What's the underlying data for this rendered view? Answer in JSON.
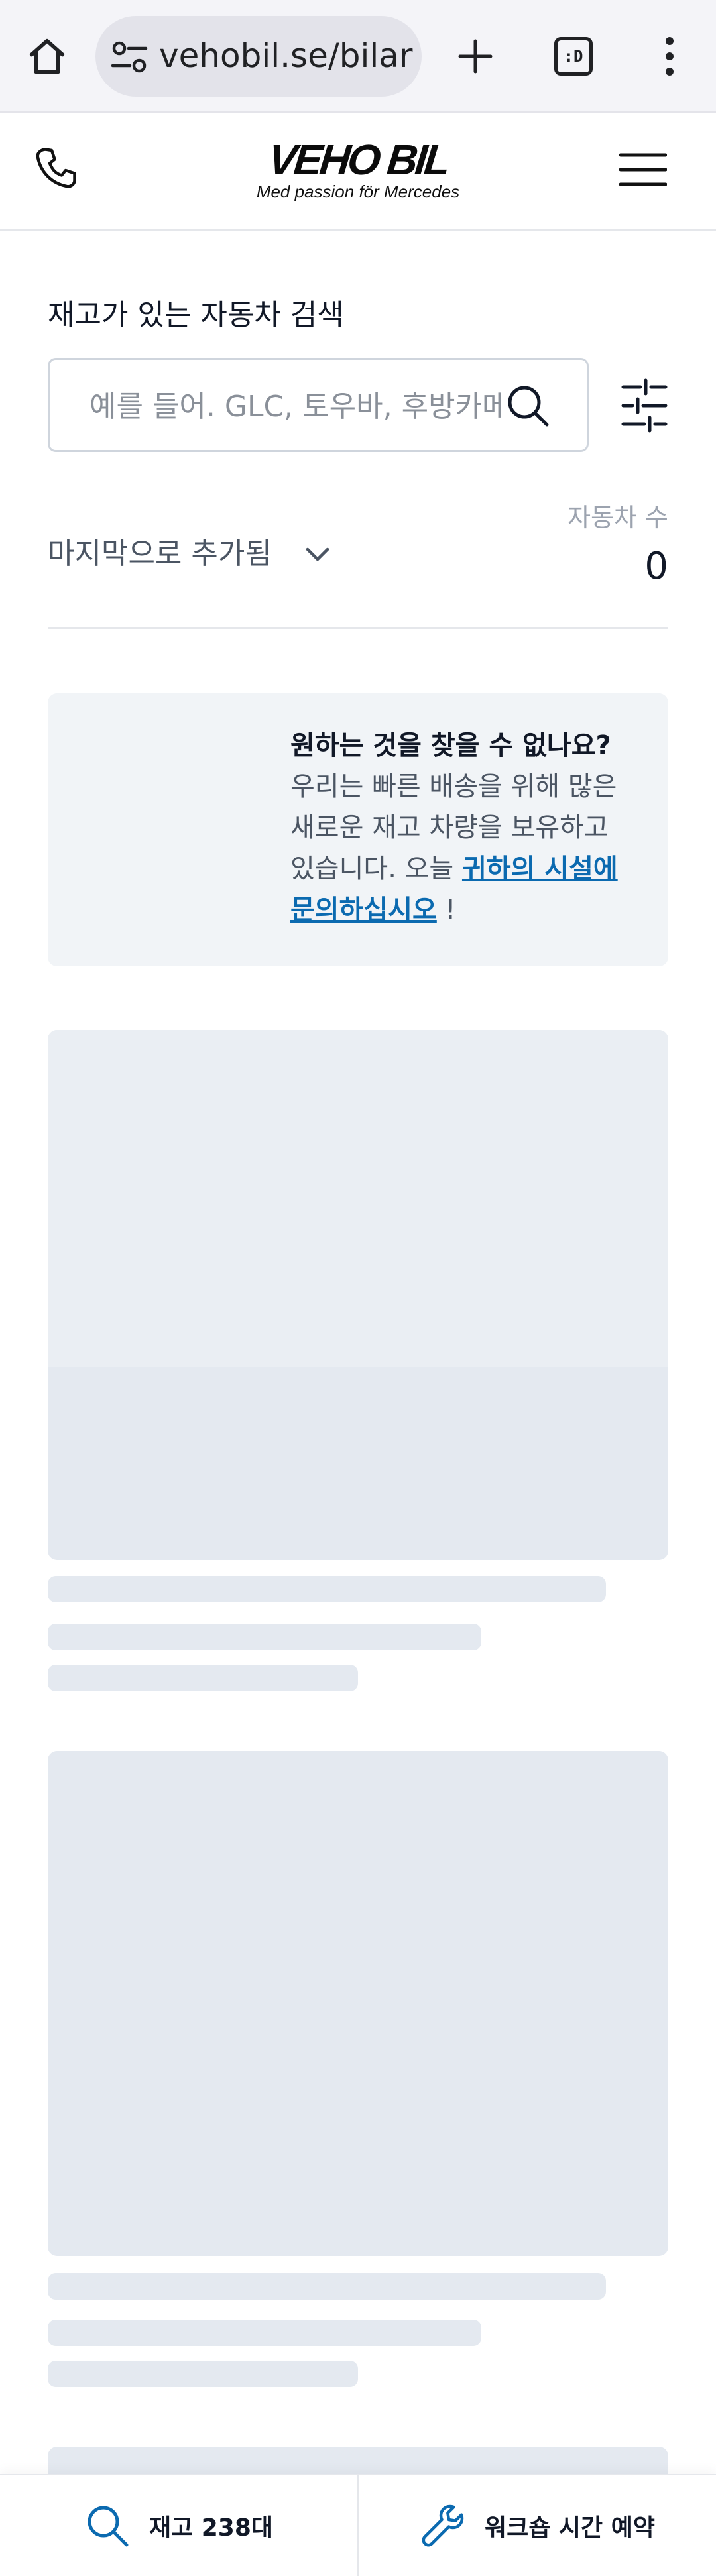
{
  "browser": {
    "url_text": "vehobil.se/bilar",
    "tab_badge": ":D"
  },
  "header": {
    "logo_brand": "VEHO BIL",
    "logo_tagline": "Med passion för Mercedes"
  },
  "search": {
    "title": "재고가 있는 자동차 검색",
    "placeholder": "예를 들어. GLC, 토우바, 후방카메라"
  },
  "sort": {
    "label": "마지막으로 추가됨"
  },
  "count": {
    "label": "자동차 수",
    "value": "0"
  },
  "info": {
    "bold": "원하는 것을 찾을 수 없나요?",
    "text": " 우리는 빠른 배송을 위해 많은 새로운 재고 차량을 보유하고 있습니다. 오늘 ",
    "link": "귀하의 시설에 문의하십시오",
    "tail": " !"
  },
  "bottom_bar": {
    "stock_label": "재고 238대",
    "workshop_label": "워크숍 시간 예약"
  },
  "colors": {
    "accent": "#0b6ab0",
    "skeleton": "#e4e9f0",
    "card_bg": "#f1f4f7"
  }
}
